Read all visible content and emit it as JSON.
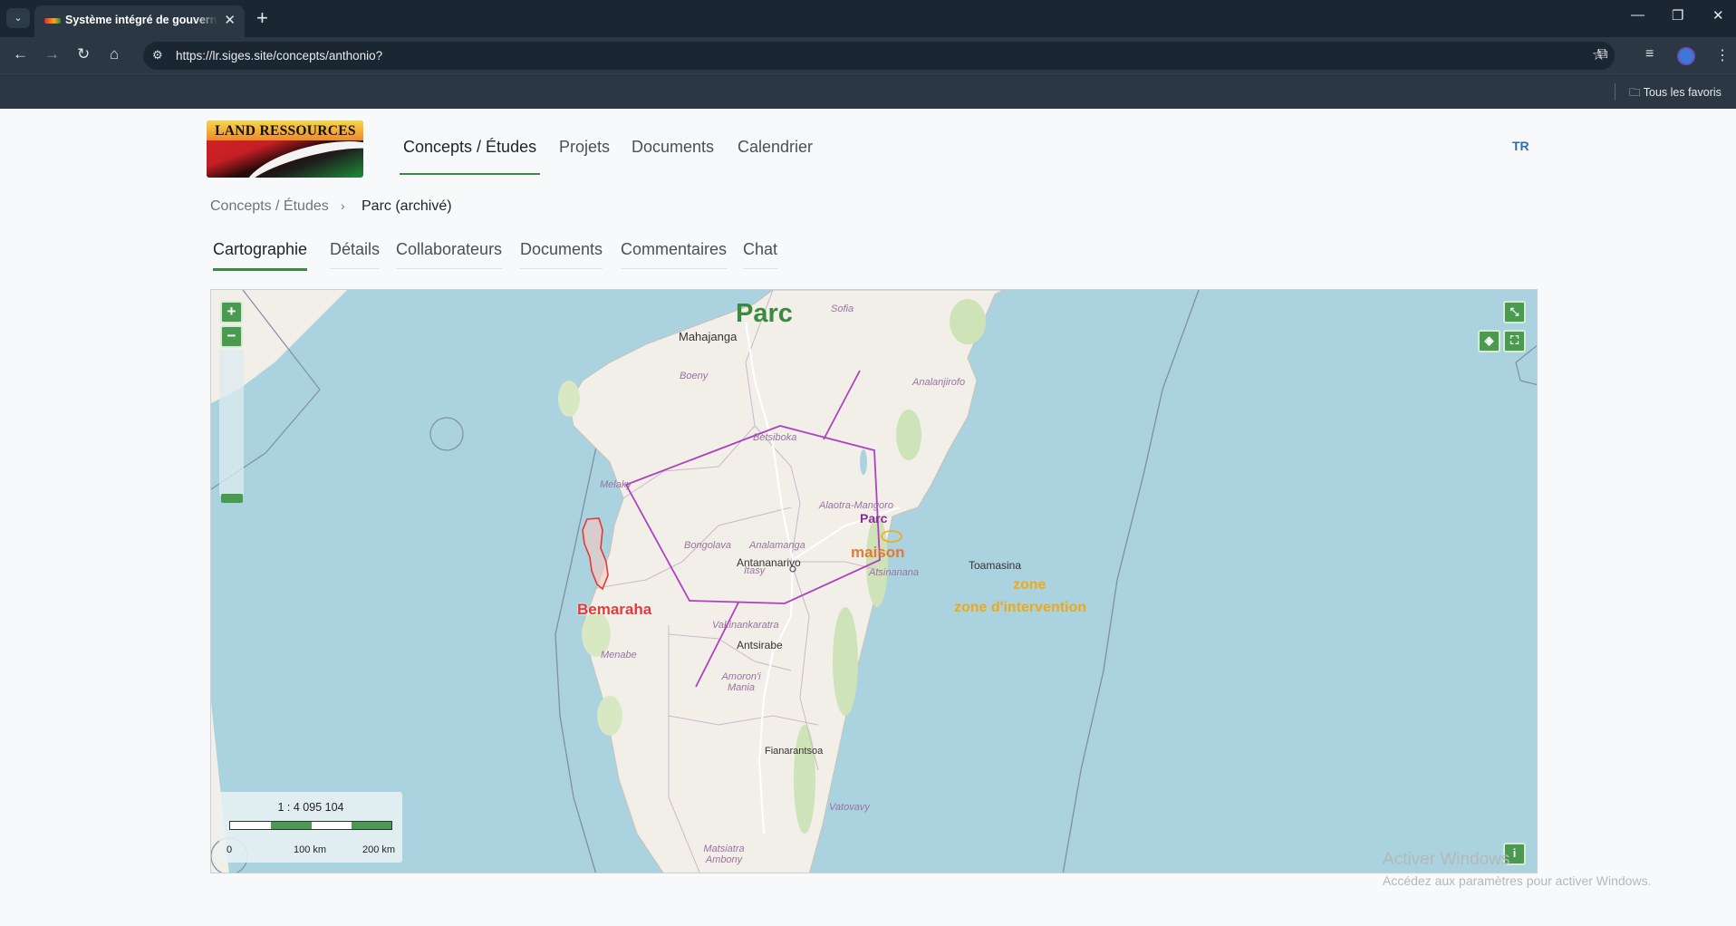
{
  "browser": {
    "tab_title": "Système intégré de gouvernance",
    "url": "https://lr.siges.site/concepts/anthonio?",
    "bookmarks_folder": "Tous les favoris"
  },
  "app": {
    "logo_text": "LAND RESSOURCES",
    "nav": [
      "Concepts / Études",
      "Projets",
      "Documents",
      "Calendrier"
    ],
    "user_initials": "TR"
  },
  "breadcrumb": {
    "root": "Concepts / Études",
    "current": "Parc (archivé)"
  },
  "subtabs": [
    "Cartographie",
    "Détails",
    "Collaborateurs",
    "Documents",
    "Commentaires",
    "Chat"
  ],
  "map": {
    "title": "Parc",
    "layers": {
      "polygon_label": "Parc",
      "point_label": "maison",
      "protected_area_label": "Bemaraha",
      "zone_small_label": "zone",
      "zone_label": "zone d'intervention"
    },
    "places": {
      "cities": [
        "Mahajanga",
        "Toamasina",
        "Antananarivo",
        "Antsirabe",
        "Fianarantsoa"
      ],
      "regions": [
        "Sofia",
        "Boeny",
        "Analanjirofo",
        "Betsiboka",
        "Melaky",
        "Alaotra-Mangoro",
        "Bongolava",
        "Analamanga",
        "Itasy",
        "Atsinanana",
        "Vakinankaratra",
        "Menabe",
        "Amoron'i Mania",
        "Vatovavy",
        "Matsiatra Ambony"
      ]
    },
    "controls": {
      "zoom_in": "+",
      "zoom_out": "−",
      "info": "i"
    },
    "scale": {
      "ratio": "1 : 4 095 104",
      "labels": [
        "0",
        "100 km",
        "200 km"
      ]
    },
    "colors": {
      "sea": "#aad3df",
      "land": "#f2efe9",
      "polygon": "#b040c0",
      "protected_area": "#e03a3a",
      "zone": "#f0a818",
      "control": "#4a9a4f"
    }
  },
  "watermark": {
    "line1": "Activer Windows",
    "line2": "Accédez aux paramètres pour activer Windows."
  }
}
